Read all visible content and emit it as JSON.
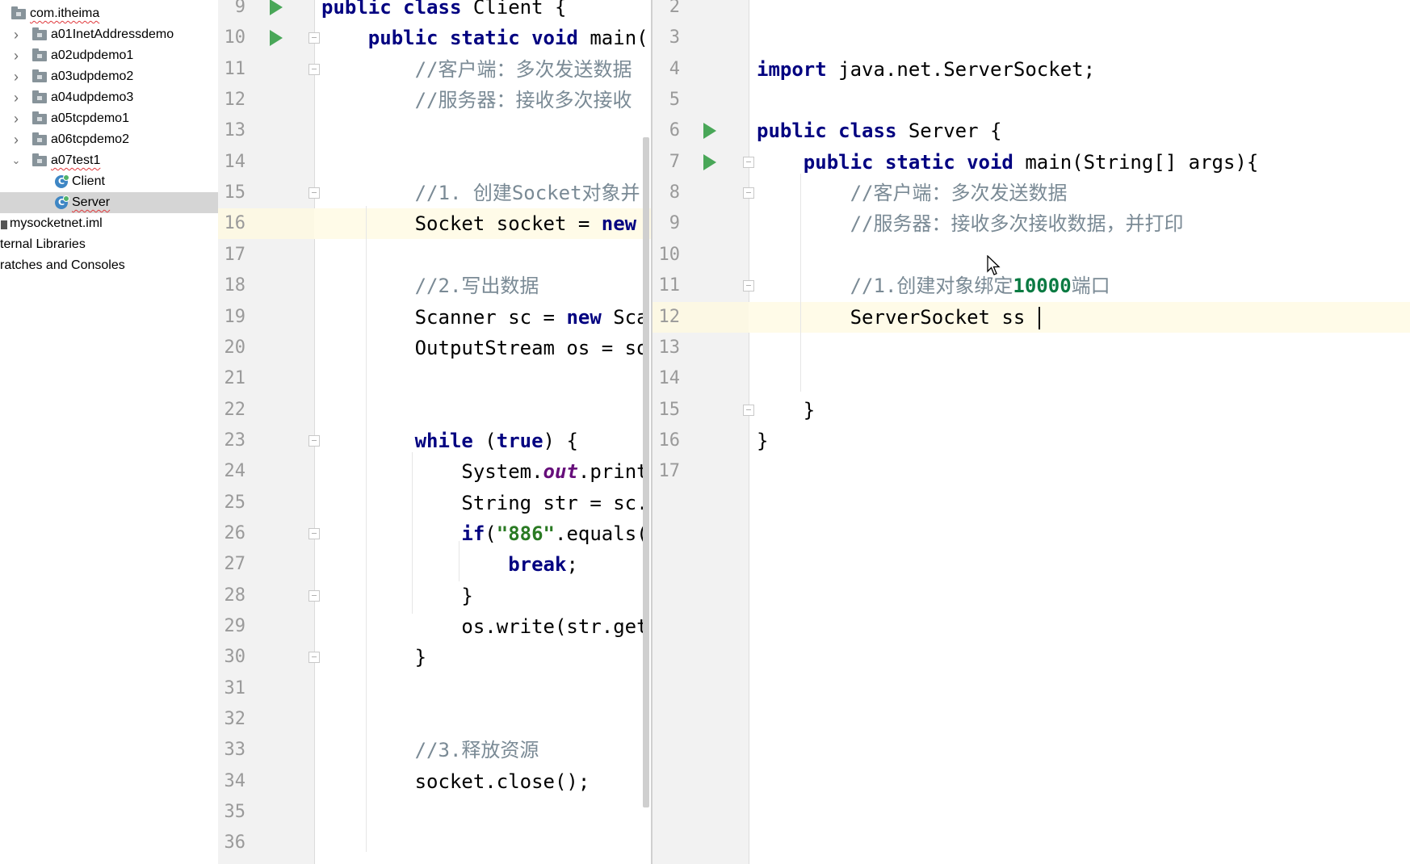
{
  "tree": {
    "items": [
      {
        "label": "com.itheima",
        "kind": "package",
        "squiggle": true
      },
      {
        "label": "a01InetAddressdemo",
        "kind": "package"
      },
      {
        "label": "a02udpdemo1",
        "kind": "package"
      },
      {
        "label": "a03udpdemo2",
        "kind": "package"
      },
      {
        "label": "a04udpdemo3",
        "kind": "package"
      },
      {
        "label": "a05tcpdemo1",
        "kind": "package"
      },
      {
        "label": "a06tcpdemo2",
        "kind": "package"
      },
      {
        "label": "a07test1",
        "kind": "package",
        "expanded": true,
        "squiggle": true
      },
      {
        "label": "Client",
        "kind": "class"
      },
      {
        "label": "Server",
        "kind": "class",
        "selected": true,
        "squiggle": true
      },
      {
        "label": "mysocketnet.iml",
        "kind": "file"
      },
      {
        "label": "ternal Libraries",
        "kind": "node"
      },
      {
        "label": "ratches and Consoles",
        "kind": "node"
      }
    ]
  },
  "editor_client": {
    "current_line": "16",
    "lines": [
      {
        "n": "9",
        "tokens": [
          [
            "kw",
            "public class "
          ],
          [
            "",
            "Client {"
          ]
        ]
      },
      {
        "n": "10",
        "tokens": [
          [
            "",
            "    "
          ],
          [
            "kw",
            "public static void "
          ],
          [
            "",
            "main("
          ]
        ]
      },
      {
        "n": "11",
        "tokens": [
          [
            "",
            "        "
          ],
          [
            "cm",
            "//客户端：多次发送数据"
          ]
        ]
      },
      {
        "n": "12",
        "tokens": [
          [
            "",
            "        "
          ],
          [
            "cm",
            "//服务器：接收多次接收"
          ]
        ]
      },
      {
        "n": "13",
        "tokens": []
      },
      {
        "n": "14",
        "tokens": []
      },
      {
        "n": "15",
        "tokens": [
          [
            "",
            "        "
          ],
          [
            "cm",
            "//1. 创建Socket对象并"
          ]
        ]
      },
      {
        "n": "16",
        "tokens": [
          [
            "",
            "        Socket socket = "
          ],
          [
            "kw",
            "new"
          ]
        ]
      },
      {
        "n": "17",
        "tokens": []
      },
      {
        "n": "18",
        "tokens": [
          [
            "",
            "        "
          ],
          [
            "cm",
            "//2.写出数据"
          ]
        ]
      },
      {
        "n": "19",
        "tokens": [
          [
            "",
            "        Scanner sc = "
          ],
          [
            "kw",
            "new "
          ],
          [
            "",
            "Sca"
          ]
        ]
      },
      {
        "n": "20",
        "tokens": [
          [
            "",
            "        OutputStream os = so"
          ]
        ]
      },
      {
        "n": "21",
        "tokens": []
      },
      {
        "n": "22",
        "tokens": []
      },
      {
        "n": "23",
        "tokens": [
          [
            "",
            "        "
          ],
          [
            "kw",
            "while "
          ],
          [
            "",
            "("
          ],
          [
            "kw",
            "true"
          ],
          [
            "",
            ") {"
          ]
        ]
      },
      {
        "n": "24",
        "tokens": [
          [
            "",
            "            System."
          ],
          [
            "fld",
            "out"
          ],
          [
            "",
            ".print"
          ]
        ]
      },
      {
        "n": "25",
        "tokens": [
          [
            "",
            "            String str = sc."
          ]
        ]
      },
      {
        "n": "26",
        "tokens": [
          [
            "",
            "            "
          ],
          [
            "kw",
            "if"
          ],
          [
            "",
            "("
          ],
          [
            "str",
            "\"886\""
          ],
          [
            "",
            ".equals("
          ]
        ]
      },
      {
        "n": "27",
        "tokens": [
          [
            "",
            "                "
          ],
          [
            "kw",
            "break"
          ],
          [
            "",
            ";"
          ]
        ]
      },
      {
        "n": "28",
        "tokens": [
          [
            "",
            "            }"
          ]
        ]
      },
      {
        "n": "29",
        "tokens": [
          [
            "",
            "            os.write(str.get"
          ]
        ]
      },
      {
        "n": "30",
        "tokens": [
          [
            "",
            "        }"
          ]
        ]
      },
      {
        "n": "31",
        "tokens": []
      },
      {
        "n": "32",
        "tokens": []
      },
      {
        "n": "33",
        "tokens": [
          [
            "",
            "        "
          ],
          [
            "cm",
            "//3.释放资源"
          ]
        ]
      },
      {
        "n": "34",
        "tokens": [
          [
            "",
            "        socket.close();"
          ]
        ]
      },
      {
        "n": "35",
        "tokens": []
      },
      {
        "n": "36",
        "tokens": []
      }
    ]
  },
  "editor_server": {
    "current_line": "12",
    "lines": [
      {
        "n": "2",
        "tokens": []
      },
      {
        "n": "3",
        "tokens": []
      },
      {
        "n": "4",
        "tokens": [
          [
            "kw",
            "import "
          ],
          [
            "",
            "java.net.ServerSocket;"
          ]
        ]
      },
      {
        "n": "5",
        "tokens": []
      },
      {
        "n": "6",
        "tokens": [
          [
            "kw",
            "public class "
          ],
          [
            "",
            "Server {"
          ]
        ]
      },
      {
        "n": "7",
        "tokens": [
          [
            "",
            "    "
          ],
          [
            "kw",
            "public static void "
          ],
          [
            "",
            "main(String[] args){"
          ]
        ]
      },
      {
        "n": "8",
        "tokens": [
          [
            "",
            "        "
          ],
          [
            "cm",
            "//客户端：多次发送数据"
          ]
        ]
      },
      {
        "n": "9",
        "tokens": [
          [
            "",
            "        "
          ],
          [
            "cm",
            "//服务器：接收多次接收数据，并打印"
          ]
        ]
      },
      {
        "n": "10",
        "tokens": []
      },
      {
        "n": "11",
        "tokens": [
          [
            "",
            "        "
          ],
          [
            "cm",
            "//1.创建对象绑定"
          ],
          [
            "cmn",
            "10000"
          ],
          [
            "cm",
            "端口"
          ]
        ]
      },
      {
        "n": "12",
        "tokens": [
          [
            "",
            "        ServerSocket ss "
          ]
        ],
        "caret": true
      },
      {
        "n": "13",
        "tokens": []
      },
      {
        "n": "14",
        "tokens": []
      },
      {
        "n": "15",
        "tokens": [
          [
            "",
            "    }"
          ]
        ]
      },
      {
        "n": "16",
        "tokens": [
          [
            "",
            "}"
          ]
        ]
      },
      {
        "n": "17",
        "tokens": []
      }
    ]
  },
  "colors": {
    "keyword": "#000080",
    "comment": "#7a8a95",
    "string": "#2a7a23",
    "run_icon": "#49a758",
    "current_line": "#fffbe8"
  }
}
